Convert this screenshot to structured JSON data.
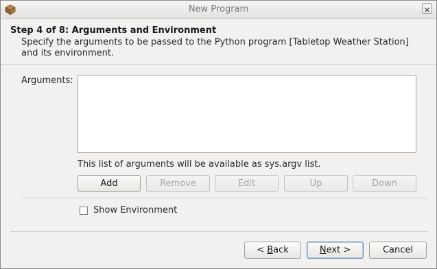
{
  "window": {
    "title": "New Program"
  },
  "header": {
    "step_title": "Step 4 of 8: Arguments and Environment",
    "description_line1": "Specify the arguments to be passed to the Python program [Tabletop Weather Station]",
    "description_line2": "and its environment."
  },
  "arguments": {
    "label": "Arguments:",
    "value": "",
    "note": "This list of arguments will be available as sys.argv list."
  },
  "toolbar": {
    "add_label": "Add",
    "remove_label": "Remove",
    "edit_label": "Edit",
    "up_label": "Up",
    "down_label": "Down"
  },
  "environment": {
    "show_label": "Show Environment",
    "checked": false
  },
  "footer": {
    "back_prefix": "< ",
    "back_mnemonic": "B",
    "back_rest": "ack",
    "next_mnemonic": "N",
    "next_rest": "ext >",
    "cancel_label": "Cancel"
  },
  "icons": {
    "app": "app-icon",
    "close": "close-icon"
  }
}
